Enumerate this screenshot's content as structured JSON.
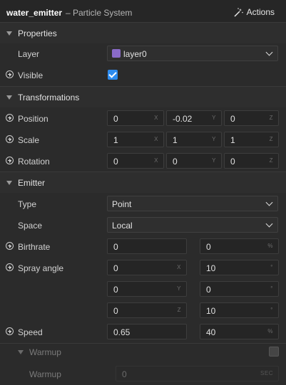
{
  "header": {
    "object_name": "water_emitter",
    "object_type": "– Particle System",
    "actions_label": "Actions"
  },
  "properties": {
    "title": "Properties",
    "layer_label": "Layer",
    "layer_value": "layer0",
    "layer_color": "#8a6bc9",
    "visible_label": "Visible",
    "visible_checked": true
  },
  "transformations": {
    "title": "Transformations",
    "position": {
      "label": "Position",
      "x": "0",
      "y": "-0.02",
      "z": "0"
    },
    "scale": {
      "label": "Scale",
      "x": "1",
      "y": "1",
      "z": "1"
    },
    "rotation": {
      "label": "Rotation",
      "x": "0",
      "y": "0",
      "z": "0"
    },
    "axis_x": "X",
    "axis_y": "Y",
    "axis_z": "Z"
  },
  "emitter": {
    "title": "Emitter",
    "type_label": "Type",
    "type_value": "Point",
    "space_label": "Space",
    "space_value": "Local",
    "birthrate_label": "Birthrate",
    "birthrate_value": "0",
    "birthrate_var": "0",
    "percent_unit": "%",
    "spray_label": "Spray angle",
    "spray_rows": [
      {
        "value": "0",
        "axis": "X",
        "angle": "10",
        "unit": "°"
      },
      {
        "value": "0",
        "axis": "Y",
        "angle": "0",
        "unit": "°"
      },
      {
        "value": "0",
        "axis": "Z",
        "angle": "10",
        "unit": "°"
      }
    ],
    "speed_label": "Speed",
    "speed_value": "0.65",
    "speed_var": "40"
  },
  "warmup": {
    "title": "Warmup",
    "enabled": false,
    "label": "Warmup",
    "value": "0",
    "unit": "SEC"
  }
}
